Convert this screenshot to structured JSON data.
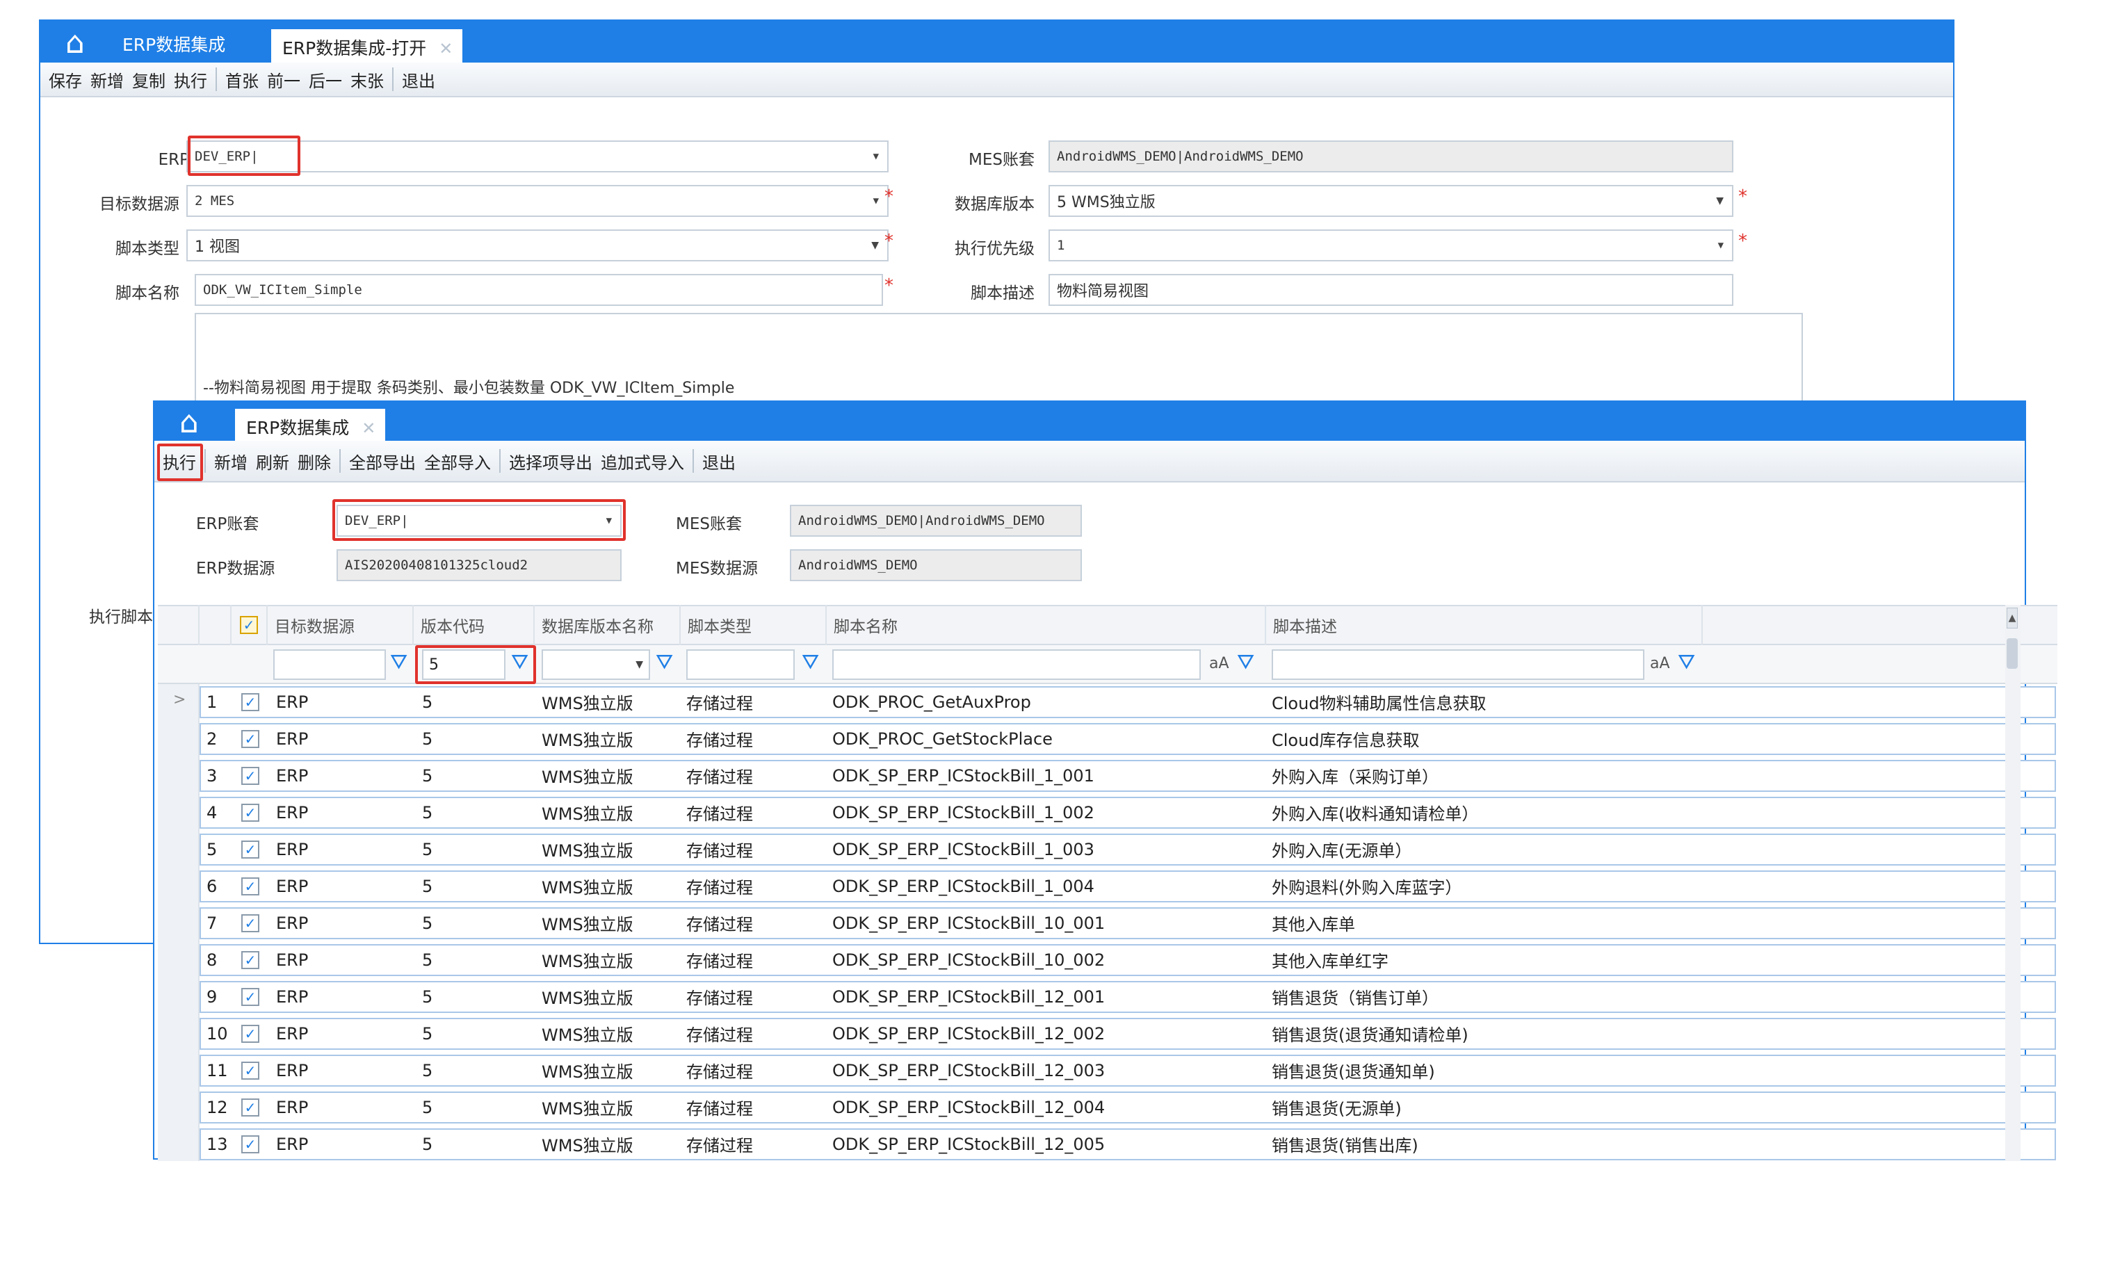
{
  "back_window": {
    "tabs": [
      "ERP数据集成",
      "ERP数据集成-打开"
    ],
    "toolbar": [
      "保存",
      "新增",
      "复制",
      "执行",
      "首张",
      "前一",
      "后一",
      "末张",
      "退出"
    ],
    "form": {
      "erp_account_label": "ERP账套",
      "erp_account_value": "DEV_ERP|",
      "mes_account_label": "MES账套",
      "mes_account_value": "AndroidWMS_DEMO|AndroidWMS_DEMO",
      "target_source_label": "目标数据源",
      "target_source_value": "2 MES",
      "db_version_label": "数据库版本",
      "db_version_value": "5 WMS独立版",
      "script_type_label": "脚本类型",
      "script_type_value": "1 视图",
      "exec_priority_label": "执行优先级",
      "exec_priority_value": "1",
      "script_name_label": "脚本名称",
      "script_name_value": "ODK_VW_ICItem_Simple",
      "script_desc_label": "脚本描述",
      "script_desc_value": "物料简易视图",
      "script_text": "--物料简易视图  用于提取  条码类别、最小包装数量   ODK_VW_ICItem_Simple",
      "exec_script_label": "执行脚本"
    }
  },
  "front_window": {
    "tabs": [
      "ERP数据集成"
    ],
    "toolbar": [
      "执行",
      "新增",
      "刷新",
      "删除",
      "全部导出",
      "全部导入",
      "选择项导出",
      "追加式导入",
      "退出"
    ],
    "form": {
      "erp_account_label": "ERP账套",
      "erp_account_value": "DEV_ERP|",
      "mes_account_label": "MES账套",
      "mes_account_value": "AndroidWMS_DEMO|AndroidWMS_DEMO",
      "erp_source_label": "ERP数据源",
      "erp_source_value": "AIS20200408101325cloud2",
      "mes_source_label": "MES数据源",
      "mes_source_value": "AndroidWMS_DEMO"
    },
    "grid": {
      "columns": [
        "目标数据源",
        "版本代码",
        "数据库版本名称",
        "脚本类型",
        "脚本名称",
        "脚本描述"
      ],
      "filter_version_code": "5",
      "filter_aa": "aA",
      "rows": [
        {
          "no": "1",
          "target": "ERP",
          "code": "5",
          "version": "WMS独立版",
          "type": "存储过程",
          "name": "ODK_PROC_GetAuxProp",
          "desc": "Cloud物料辅助属性信息获取"
        },
        {
          "no": "2",
          "target": "ERP",
          "code": "5",
          "version": "WMS独立版",
          "type": "存储过程",
          "name": "ODK_PROC_GetStockPlace",
          "desc": "Cloud库存信息获取"
        },
        {
          "no": "3",
          "target": "ERP",
          "code": "5",
          "version": "WMS独立版",
          "type": "存储过程",
          "name": "ODK_SP_ERP_ICStockBill_1_001",
          "desc": "外购入库（采购订单）"
        },
        {
          "no": "4",
          "target": "ERP",
          "code": "5",
          "version": "WMS独立版",
          "type": "存储过程",
          "name": "ODK_SP_ERP_ICStockBill_1_002",
          "desc": "外购入库(收料通知请检单）"
        },
        {
          "no": "5",
          "target": "ERP",
          "code": "5",
          "version": "WMS独立版",
          "type": "存储过程",
          "name": "ODK_SP_ERP_ICStockBill_1_003",
          "desc": "外购入库(无源单）"
        },
        {
          "no": "6",
          "target": "ERP",
          "code": "5",
          "version": "WMS独立版",
          "type": "存储过程",
          "name": "ODK_SP_ERP_ICStockBill_1_004",
          "desc": "外购退料(外购入库蓝字）"
        },
        {
          "no": "7",
          "target": "ERP",
          "code": "5",
          "version": "WMS独立版",
          "type": "存储过程",
          "name": "ODK_SP_ERP_ICStockBill_10_001",
          "desc": "其他入库单"
        },
        {
          "no": "8",
          "target": "ERP",
          "code": "5",
          "version": "WMS独立版",
          "type": "存储过程",
          "name": "ODK_SP_ERP_ICStockBill_10_002",
          "desc": "其他入库单红字"
        },
        {
          "no": "9",
          "target": "ERP",
          "code": "5",
          "version": "WMS独立版",
          "type": "存储过程",
          "name": "ODK_SP_ERP_ICStockBill_12_001",
          "desc": "销售退货（销售订单）"
        },
        {
          "no": "10",
          "target": "ERP",
          "code": "5",
          "version": "WMS独立版",
          "type": "存储过程",
          "name": "ODK_SP_ERP_ICStockBill_12_002",
          "desc": "销售退货(退货通知请检单)"
        },
        {
          "no": "11",
          "target": "ERP",
          "code": "5",
          "version": "WMS独立版",
          "type": "存储过程",
          "name": "ODK_SP_ERP_ICStockBill_12_003",
          "desc": "销售退货(退货通知单)"
        },
        {
          "no": "12",
          "target": "ERP",
          "code": "5",
          "version": "WMS独立版",
          "type": "存储过程",
          "name": "ODK_SP_ERP_ICStockBill_12_004",
          "desc": "销售退货(无源单)"
        },
        {
          "no": "13",
          "target": "ERP",
          "code": "5",
          "version": "WMS独立版",
          "type": "存储过程",
          "name": "ODK_SP_ERP_ICStockBill_12_005",
          "desc": "销售退货(销售出库)"
        }
      ]
    }
  },
  "icons": {
    "home": "home-icon",
    "filter": "filter-icon",
    "dropdown": "chevron-down-icon",
    "close": "close-icon",
    "check": "checkbox-icon"
  },
  "colors": {
    "accent": "#1f7fe6",
    "highlight": "#e0322c",
    "row_border": "#a9c7e8",
    "required": "#e0322c"
  }
}
